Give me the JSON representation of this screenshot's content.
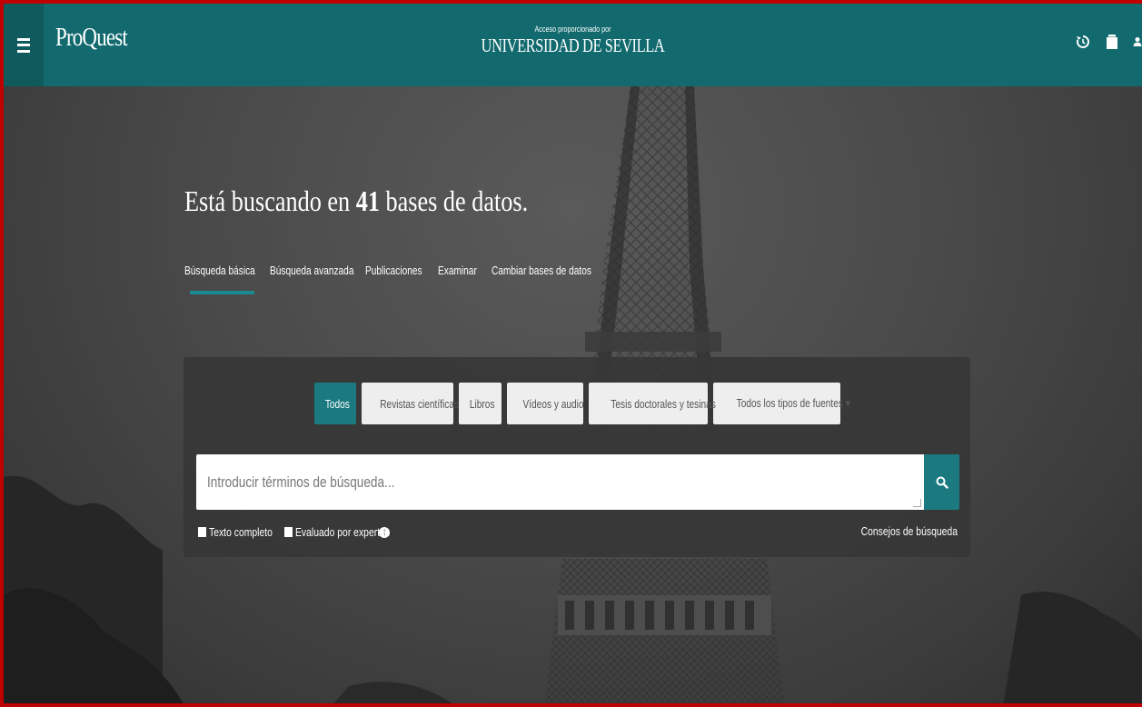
{
  "header": {
    "logo": "ProQuest",
    "access_label": "Acceso proporcionado por",
    "institution": "UNIVERSIDAD DE SEVILLA",
    "icons": [
      "history-icon",
      "folder-icon",
      "user-icon"
    ]
  },
  "hero": {
    "heading_prefix": "Está buscando en ",
    "heading_count": "41",
    "heading_suffix": " bases de datos."
  },
  "tabs": [
    {
      "label": "Búsqueda básica",
      "active": true
    },
    {
      "label": "Búsqueda avanzada"
    },
    {
      "label": "Publicaciones"
    },
    {
      "label": "Examinar"
    },
    {
      "label": "Cambiar bases de datos"
    }
  ],
  "source_types": [
    {
      "label": "Todos",
      "active": true
    },
    {
      "label": "Revistas científicas"
    },
    {
      "label": "Libros"
    },
    {
      "label": "Vídeos y audio"
    },
    {
      "label": "Tesis doctorales y tesinas"
    },
    {
      "label": "Todos los tipos de fuentes ▾"
    }
  ],
  "search": {
    "placeholder": "Introducir términos de búsqueda...",
    "full_text_label": "Texto completo",
    "peer_reviewed_label": "Evaluado por expertos",
    "tips_label": "Consejos de búsqueda"
  },
  "colors": {
    "header": "#126a6e",
    "accent": "#1a7a80",
    "frame": "#c00000"
  }
}
